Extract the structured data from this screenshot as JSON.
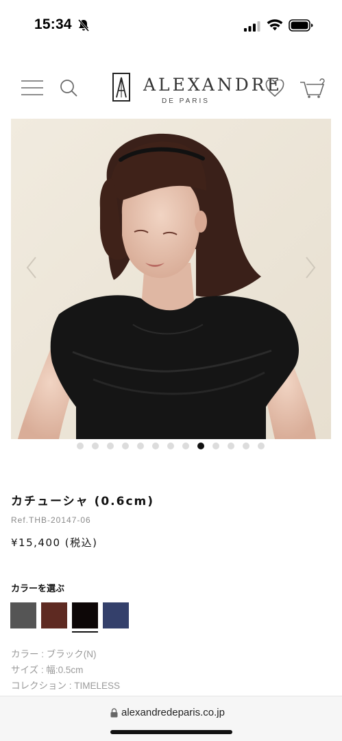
{
  "status_bar": {
    "time": "15:34",
    "icons": [
      "bell-slash-icon",
      "signal-icon",
      "wifi-icon",
      "battery-icon"
    ]
  },
  "header": {
    "menu_icon": "menu-icon",
    "search_icon": "search-icon",
    "brand_name": "ALEXANDRE",
    "brand_sub": "DE PARIS",
    "wishlist_icon": "heart-icon",
    "cart_icon": "cart-icon"
  },
  "gallery": {
    "slide_count": 13,
    "active_index": 8,
    "prev_icon": "chevron-left-icon",
    "next_icon": "chevron-right-icon"
  },
  "product": {
    "name": "カチューシャ (0.6cm)",
    "ref": "Ref.THB-20147-06",
    "price": "¥15,400 (税込)"
  },
  "colors": {
    "title": "カラーを選ぶ",
    "swatches": [
      "#555555",
      "#5e2a22",
      "#0d0707",
      "#34406b"
    ],
    "selected_index": 2
  },
  "specs": {
    "color": "カラー : ブラック(N)",
    "size": "サイズ : 幅:0.5cm",
    "collection": "コレクション : TIMELESS"
  },
  "browser": {
    "url": "alexandredeparis.co.jp",
    "lock_icon": "lock-icon"
  }
}
